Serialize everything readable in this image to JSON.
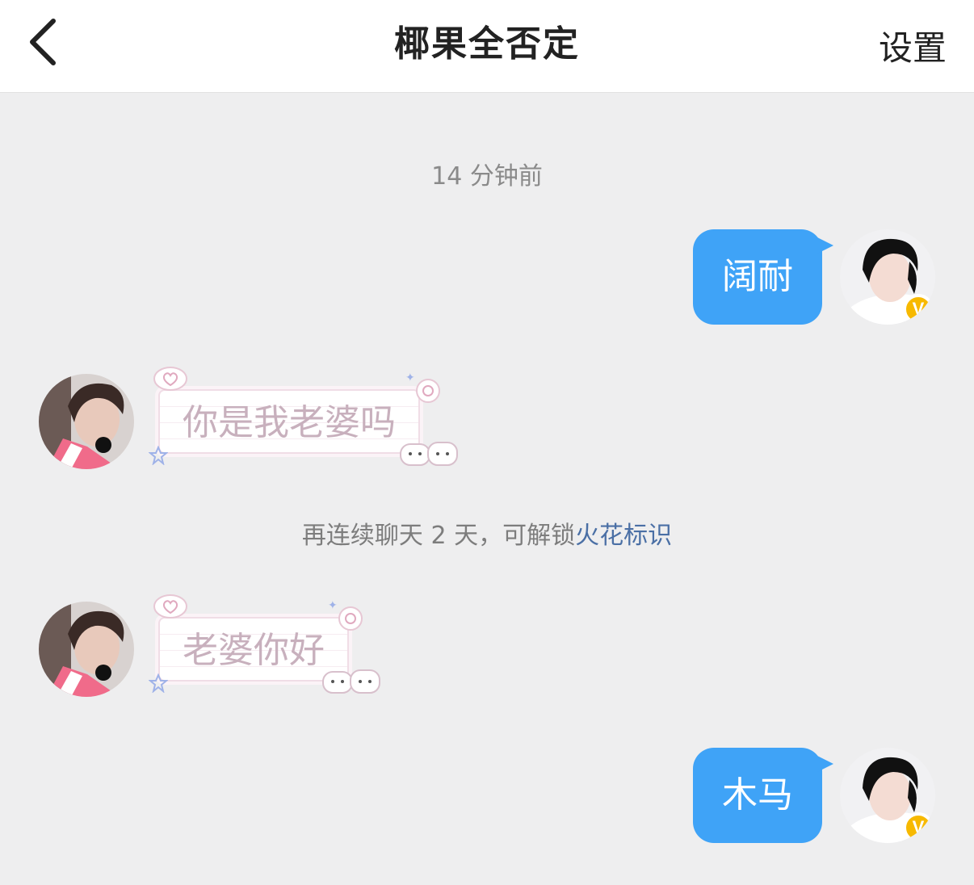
{
  "header": {
    "title": "椰果全否定",
    "settings_label": "设置"
  },
  "timestamp": "14 分钟前",
  "messages": [
    {
      "side": "out",
      "text": "阔耐"
    },
    {
      "side": "in",
      "text": "你是我老婆吗"
    },
    {
      "side": "in",
      "text": "老婆你好"
    },
    {
      "side": "out",
      "text": "木马"
    }
  ],
  "system_notice": {
    "text": "再连续聊天 2 天，可解锁",
    "link": "火花标识"
  },
  "badge_letter": "V",
  "colors": {
    "outgoing_bubble": "#3fa3f7",
    "badge": "#f7b900",
    "link": "#4a6fa5"
  }
}
